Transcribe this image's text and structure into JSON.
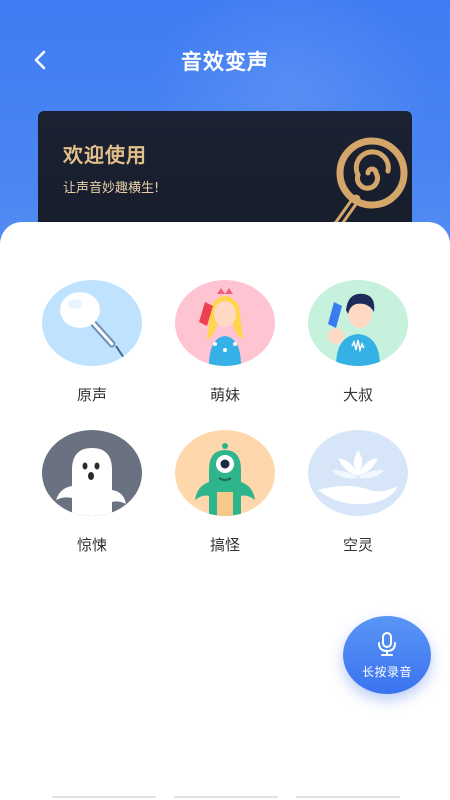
{
  "header": {
    "title": "音效变声",
    "back_icon": "chevron-left-icon"
  },
  "banner": {
    "title": "欢迎使用",
    "subtitle": "让声音妙趣横生!",
    "illustration": "lollipop-icon"
  },
  "effects": [
    {
      "label": "原声",
      "icon": "microphone-avatar-icon",
      "color": "#bfe2ff"
    },
    {
      "label": "萌妹",
      "icon": "cute-girl-avatar-icon",
      "color": "#ffc4d2"
    },
    {
      "label": "大叔",
      "icon": "man-avatar-icon",
      "color": "#c5f1dd"
    },
    {
      "label": "惊悚",
      "icon": "ghost-avatar-icon",
      "color": "#6a7282"
    },
    {
      "label": "搞怪",
      "icon": "monster-avatar-icon",
      "color": "#ffd7ad"
    },
    {
      "label": "空灵",
      "icon": "lotus-avatar-icon",
      "color": "#d6e6f8"
    }
  ],
  "record_button": {
    "label": "长按录音",
    "icon": "microphone-icon"
  },
  "colors": {
    "header_blue": "#3f7cf3",
    "banner_dark": "#1b2233",
    "banner_gold": "#e3c08a",
    "record_blue": "#3b73ef"
  }
}
